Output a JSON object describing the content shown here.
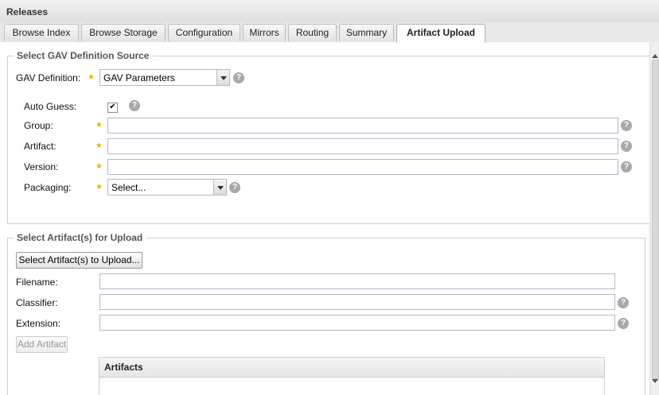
{
  "panel": {
    "title": "Releases"
  },
  "tabs": [
    {
      "label": "Browse Index"
    },
    {
      "label": "Browse Storage"
    },
    {
      "label": "Configuration"
    },
    {
      "label": "Mirrors"
    },
    {
      "label": "Routing"
    },
    {
      "label": "Summary"
    },
    {
      "label": "Artifact Upload",
      "active": true
    }
  ],
  "gav_section": {
    "legend": "Select GAV Definition Source",
    "definition_label": "GAV Definition:",
    "definition_value": "GAV Parameters",
    "auto_guess_label": "Auto Guess:",
    "auto_guess_checked": true,
    "group_label": "Group:",
    "artifact_label": "Artifact:",
    "version_label": "Version:",
    "packaging_label": "Packaging:",
    "packaging_value": "Select...",
    "group_value": "",
    "artifact_value": "",
    "version_value": ""
  },
  "upload_section": {
    "legend": "Select Artifact(s) for Upload",
    "select_button": "Select Artifact(s) to Upload...",
    "filename_label": "Filename:",
    "classifier_label": "Classifier:",
    "extension_label": "Extension:",
    "add_button": "Add Artifact",
    "filename_value": "",
    "classifier_value": "",
    "extension_value": ""
  },
  "artifacts_grid": {
    "header": "Artifacts"
  },
  "icons": {
    "help": "help-icon",
    "required": "required-star-icon"
  },
  "colors": {
    "required_star": "#f3b200",
    "help_icon": "#a9a9a9"
  }
}
